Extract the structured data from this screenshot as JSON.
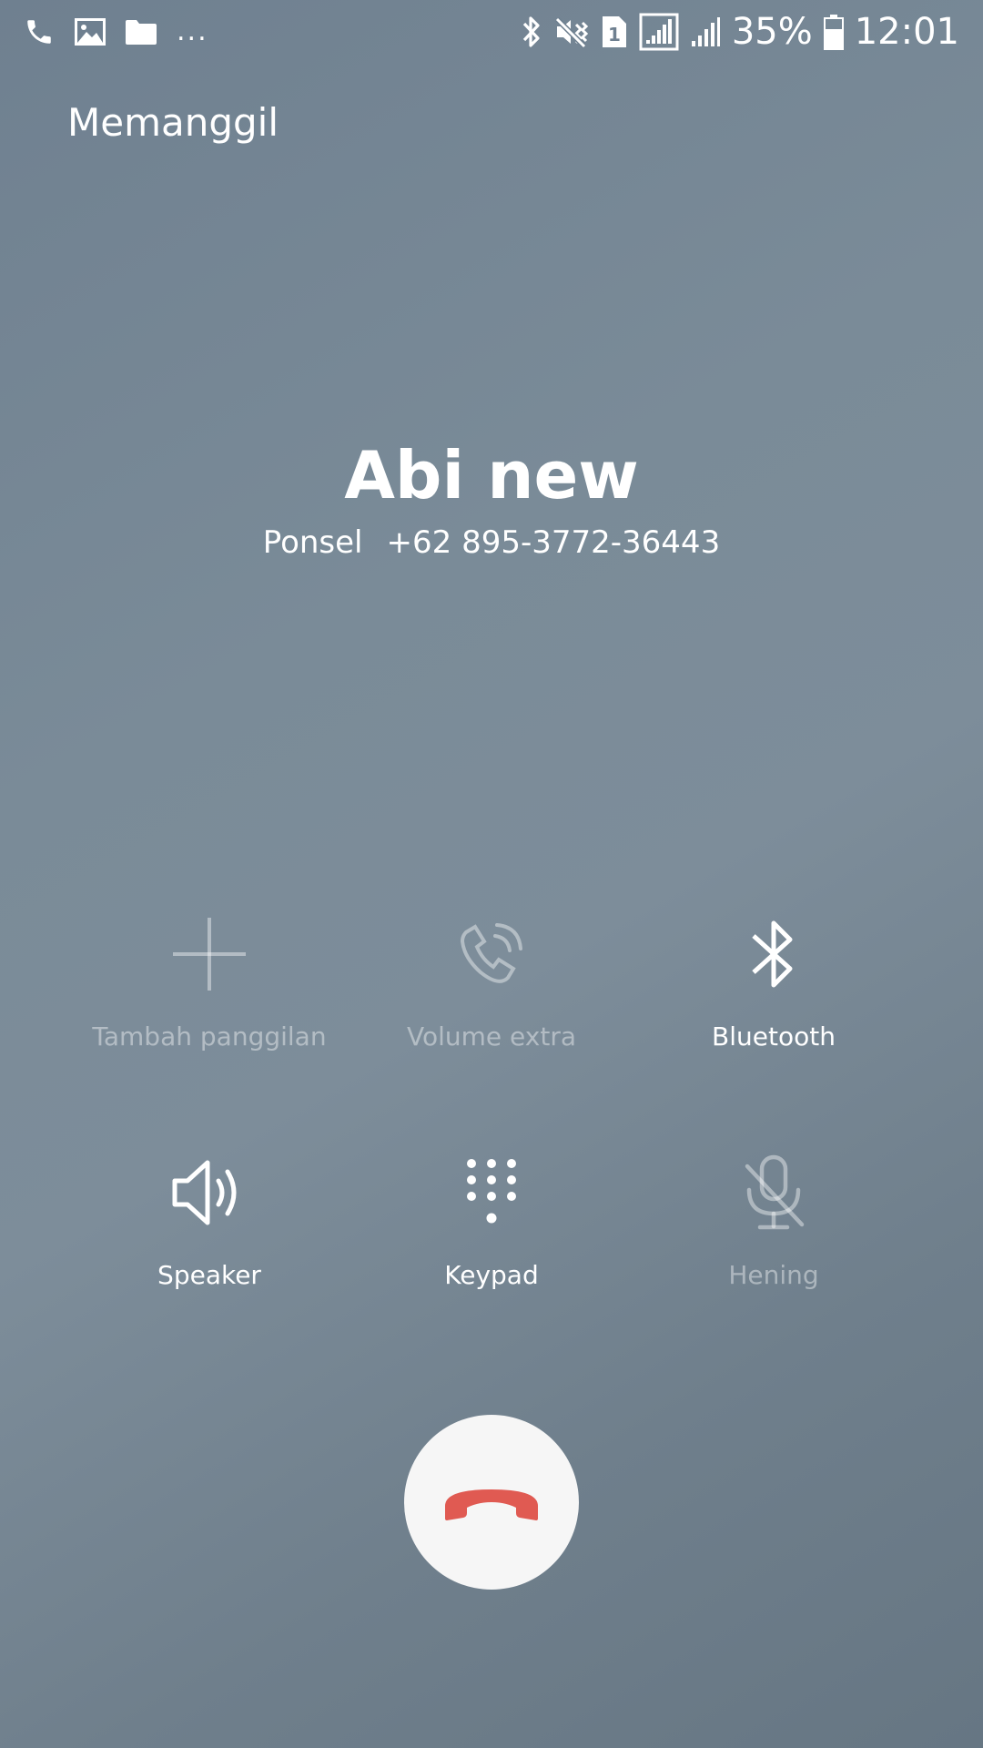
{
  "status_bar": {
    "left_icons": [
      "phone-icon",
      "image-icon",
      "folder-icon"
    ],
    "more": "...",
    "right_icons": [
      "bluetooth-icon",
      "mute-vibrate-icon",
      "sim1-icon",
      "signal-icon",
      "signal-icon"
    ],
    "battery": "35%",
    "time": "12:01"
  },
  "call": {
    "state": "Memanggil",
    "contact_name": "Abi new",
    "number_label": "Ponsel",
    "number": "+62 895-3772-36443"
  },
  "controls": [
    {
      "label": "Tambah panggilan",
      "icon": "plus-icon",
      "enabled": false
    },
    {
      "label": "Volume extra",
      "icon": "volume-extra-icon",
      "enabled": false
    },
    {
      "label": "Bluetooth",
      "icon": "bluetooth-icon",
      "enabled": true
    },
    {
      "label": "Speaker",
      "icon": "speaker-icon",
      "enabled": true
    },
    {
      "label": "Keypad",
      "icon": "keypad-icon",
      "enabled": true
    },
    {
      "label": "Hening",
      "icon": "mic-off-icon",
      "enabled": false
    }
  ],
  "end_call": {
    "icon": "end-call-icon",
    "color": "#e05a52"
  }
}
